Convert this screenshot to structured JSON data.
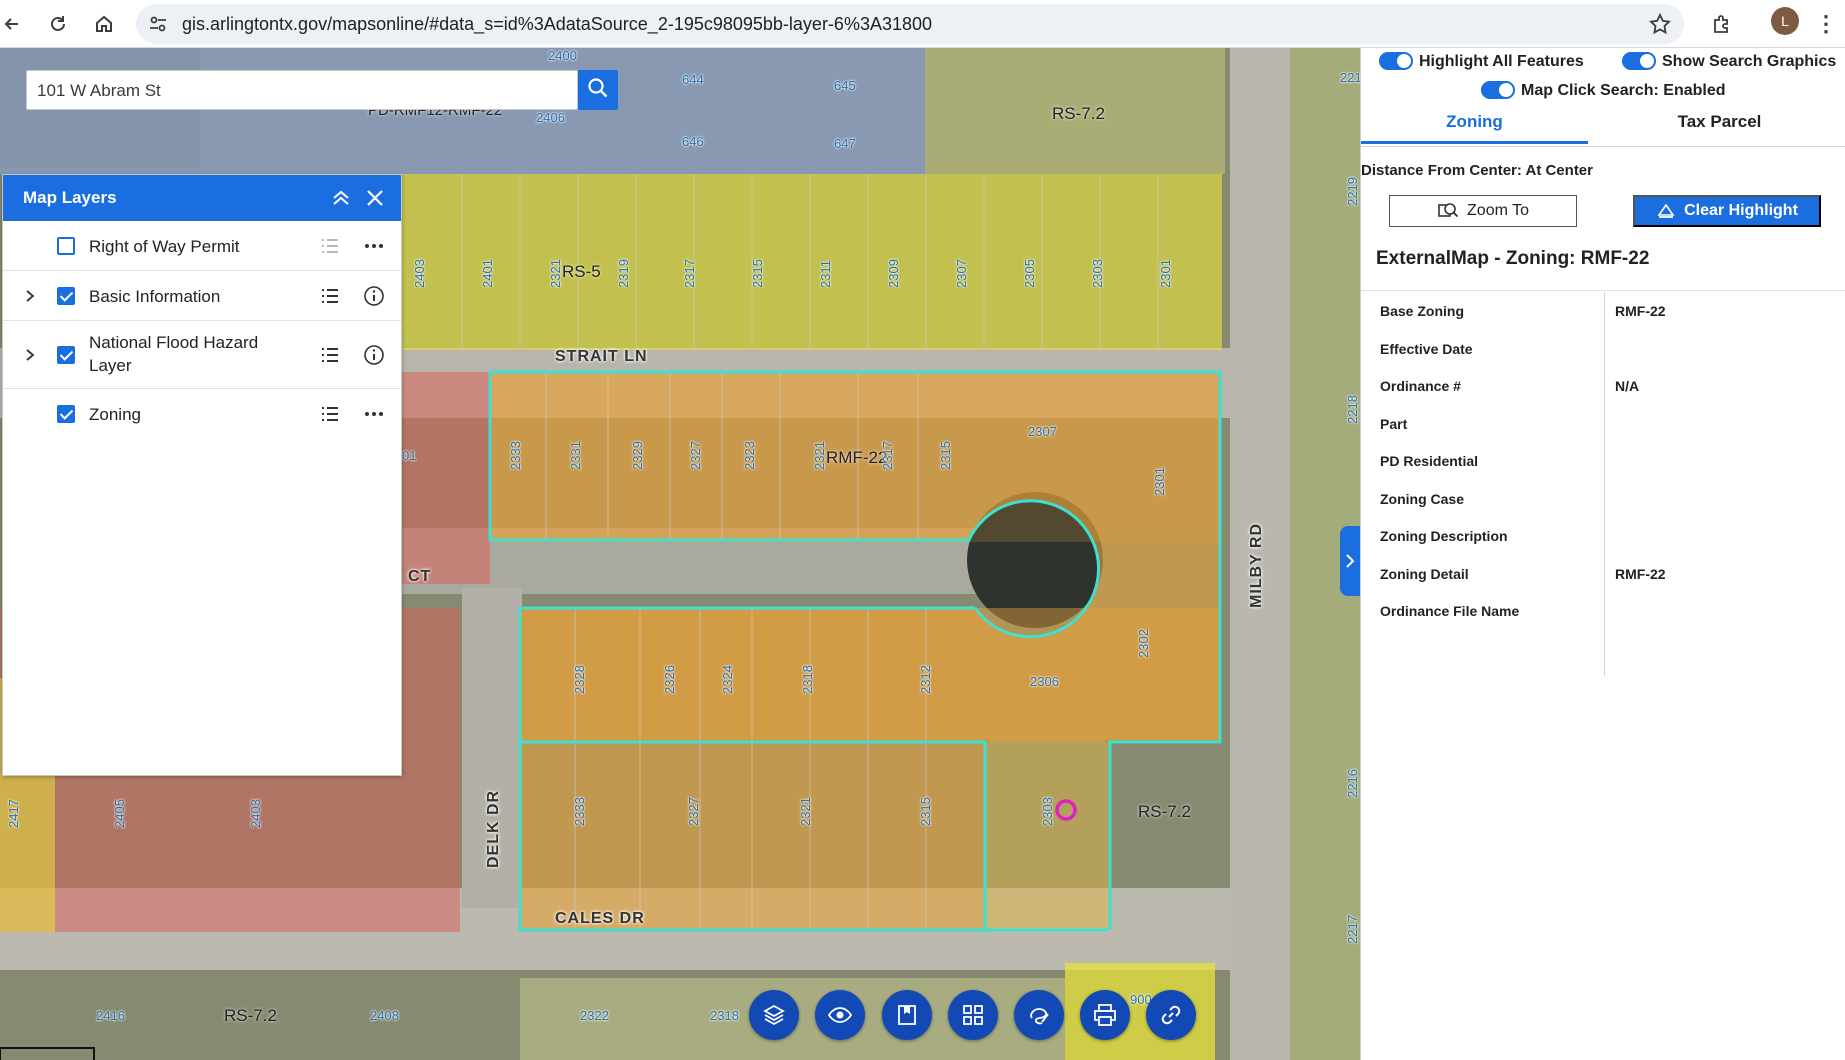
{
  "browser": {
    "url": "gis.arlingtontx.gov/mapsonline/#data_s=id%3AdataSource_2-195c98095bb-layer-6%3A31800",
    "profile_initial": "L",
    "icons": [
      "back-arrow-icon",
      "reload-icon",
      "home-icon",
      "site-settings-icon",
      "star-icon",
      "extensions-icon",
      "kebab-menu-icon"
    ]
  },
  "search": {
    "value": "101 W Abram St",
    "icon": "search-icon"
  },
  "map_layers": {
    "title": "Map Layers",
    "items": [
      {
        "label": "Right of Way Permit",
        "checked": false,
        "expandable": false,
        "list_icon_enabled": false,
        "action_icon": "more-icon"
      },
      {
        "label": "Basic Information",
        "checked": true,
        "expandable": true,
        "list_icon_enabled": true,
        "action_icon": "info-icon"
      },
      {
        "label": "National Flood Hazard Layer",
        "checked": true,
        "expandable": true,
        "list_icon_enabled": true,
        "action_icon": "info-icon"
      },
      {
        "label": "Zoning",
        "checked": true,
        "expandable": false,
        "list_icon_enabled": true,
        "action_icon": "more-icon"
      }
    ]
  },
  "map": {
    "streets": [
      "STRAIT LN",
      "CALES DR",
      "MILBY RD",
      "DELK DR",
      "CT"
    ],
    "zones": [
      "RS-5",
      "RMF-22",
      "RS-7.2",
      "RS-7.2",
      "RS-7.2",
      "PD-RMF12-RMF-22"
    ],
    "addresses_top_row": [
      "2403",
      "2401",
      "2321",
      "2319",
      "2317",
      "2315",
      "2311",
      "2309",
      "2307",
      "2305",
      "2303",
      "2301"
    ],
    "addresses_mid_row": [
      "2333",
      "2331",
      "2329",
      "2327",
      "2323",
      "2321",
      "2317",
      "2315",
      "2307",
      "2301"
    ],
    "addresses_low_row": [
      "2328",
      "2326",
      "2324",
      "2318",
      "2312",
      "2306",
      "2302"
    ],
    "addresses_bottom_row": [
      "2333",
      "2327",
      "2321",
      "2315",
      "2303"
    ],
    "addresses_misc": [
      "2400",
      "2406",
      "644",
      "645",
      "646",
      "647",
      "2405",
      "2403",
      "2417",
      "2416",
      "2408",
      "2322",
      "2318",
      "2218",
      "2216",
      "2217",
      "2219",
      "900",
      "221",
      "01"
    ],
    "colors": {
      "rs_zone": "#e8e23a",
      "rmf_zone": "#e6a23c",
      "pd_zone": "#8aa6e8",
      "commercial_zone": "#d9625a",
      "highlight": "#3fe0d0",
      "marker": "#e020c0"
    }
  },
  "toolbar": [
    "layers-icon",
    "eye-icon",
    "bookmark-icon",
    "grid-icon",
    "draw-icon",
    "print-icon",
    "link-icon"
  ],
  "panel": {
    "toggles": [
      {
        "label": "Highlight All Features",
        "on": true
      },
      {
        "label": "Show Search Graphics",
        "on": true
      },
      {
        "label": "Map Click Search: Enabled",
        "on": true
      }
    ],
    "tabs": [
      {
        "label": "Zoning",
        "active": true
      },
      {
        "label": "Tax Parcel",
        "active": false
      }
    ],
    "distance": "Distance From Center: At Center",
    "zoom_button": "Zoom To",
    "clear_button": "Clear Highlight",
    "feature_title": "ExternalMap - Zoning: RMF-22",
    "attributes": [
      {
        "key": "Base Zoning",
        "value": "RMF-22"
      },
      {
        "key": "Effective Date",
        "value": ""
      },
      {
        "key": "Ordinance #",
        "value": "N/A"
      },
      {
        "key": "Part",
        "value": ""
      },
      {
        "key": "PD Residential",
        "value": ""
      },
      {
        "key": "Zoning Case",
        "value": ""
      },
      {
        "key": "Zoning Description",
        "value": ""
      },
      {
        "key": "Zoning Detail",
        "value": "RMF-22"
      },
      {
        "key": "Ordinance File Name",
        "value": ""
      }
    ]
  }
}
